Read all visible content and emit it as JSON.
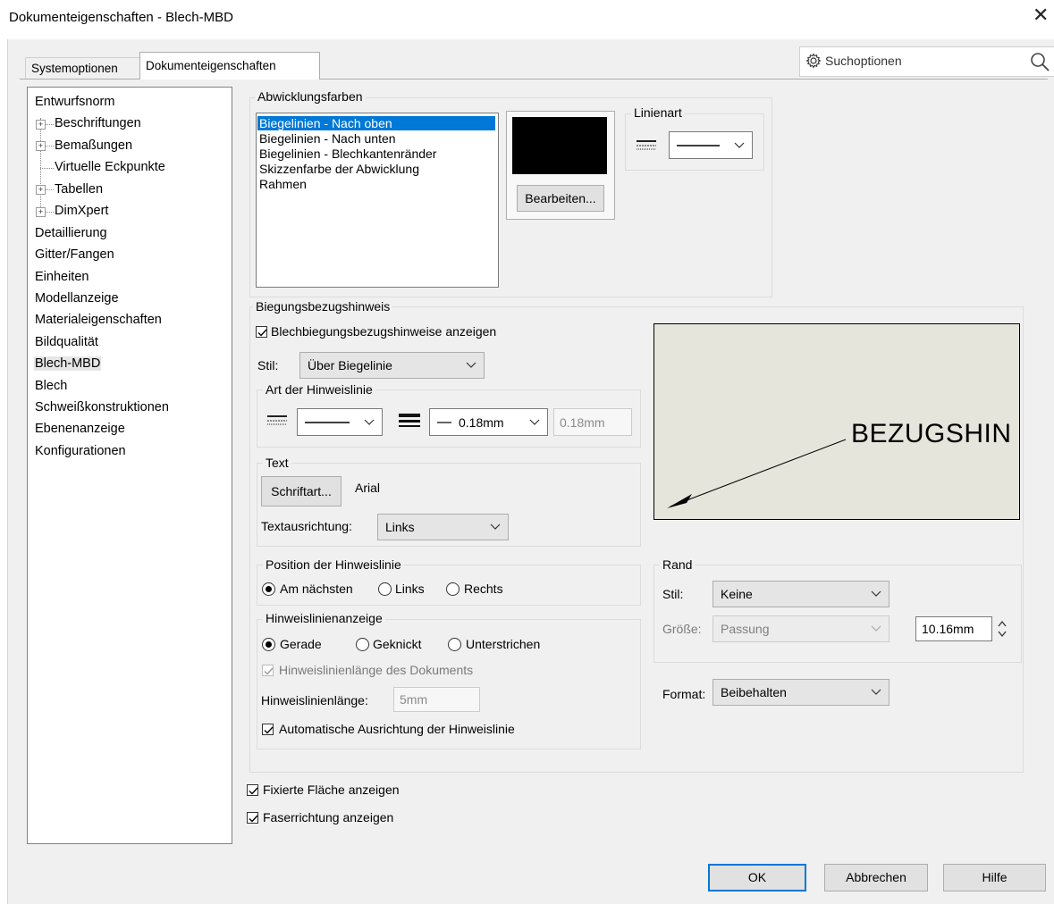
{
  "window": {
    "title": "Dokumenteigenschaften - Blech-MBD",
    "close_icon": "close-icon"
  },
  "tabs": {
    "system": "Systemoptionen",
    "document": "Dokumenteigenschaften"
  },
  "search": {
    "placeholder": "Suchoptionen"
  },
  "tree": {
    "items": [
      "Entwurfsnorm",
      "Beschriftungen",
      "Bemaßungen",
      "Virtuelle Eckpunkte",
      "Tabellen",
      "DimXpert",
      "Detaillierung",
      "Gitter/Fangen",
      "Einheiten",
      "Modellanzeige",
      "Materialeigenschaften",
      "Bildqualität",
      "Blech-MBD",
      "Blech",
      "Schweißkonstruktionen",
      "Ebenenanzeige",
      "Konfigurationen"
    ],
    "selected": "Blech-MBD"
  },
  "flat_colors": {
    "label": "Abwicklungsfarben",
    "items": [
      "Biegelinien - Nach oben",
      "Biegelinien - Nach unten",
      "Biegelinien - Blechkantenränder",
      "Skizzenfarbe der Abwicklung",
      "Rahmen"
    ],
    "selected_index": 0,
    "swatch_color": "#000000",
    "edit_button": "Bearbeiten...",
    "linetype_label": "Linienart"
  },
  "bend_notes": {
    "label": "Biegungsbezugshinweis",
    "show_label": "Blechbiegungsbezugshinweise anzeigen",
    "show_checked": true,
    "style_label": "Stil:",
    "style_value": "Über Biegelinie",
    "leader_type_label": "Art der Hinweislinie",
    "line_weight_value": "0.18mm",
    "line_weight_custom": "0.18mm",
    "text_group_label": "Text",
    "font_button": "Schriftart...",
    "font_name": "Arial",
    "text_align_label": "Textausrichtung:",
    "text_align_value": "Links",
    "position_label": "Position der Hinweislinie",
    "position_options": [
      "Am nächsten",
      "Links",
      "Rechts"
    ],
    "position_selected": 0,
    "display_label": "Hinweislinienanzeige",
    "display_options": [
      "Gerade",
      "Geknickt",
      "Unterstrichen"
    ],
    "display_selected": 0,
    "doc_length_label": "Hinweislinienlänge des Dokuments",
    "doc_length_checked": true,
    "length_label": "Hinweislinienlänge:",
    "length_value": "5mm",
    "auto_align_label": "Automatische Ausrichtung der Hinweislinie",
    "auto_align_checked": true,
    "preview_text": "BEZUGSHIN"
  },
  "border": {
    "label": "Rand",
    "style_label": "Stil:",
    "style_value": "Keine",
    "size_label": "Größe:",
    "size_value": "Passung",
    "size_number": "10.16mm",
    "format_label": "Format:",
    "format_value": "Beibehalten"
  },
  "bottom_options": {
    "fixed_face": "Fixierte Fläche anzeigen",
    "fixed_face_checked": true,
    "grain": "Faserrichtung anzeigen",
    "grain_checked": true
  },
  "footer": {
    "ok": "OK",
    "cancel": "Abbrechen",
    "help": "Hilfe"
  },
  "colors": {
    "selection": "#0078d7",
    "dialog_bg": "#f0f0f0",
    "preview_bg": "#e6e5dc"
  }
}
